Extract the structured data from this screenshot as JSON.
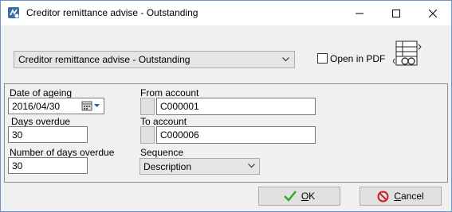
{
  "window": {
    "title": "Creditor remittance advise - Outstanding"
  },
  "report": {
    "selected": "Creditor remittance advise - Outstanding",
    "open_in_pdf_label": "Open in PDF",
    "open_in_pdf_checked": false
  },
  "form": {
    "date_of_ageing_label": "Date of ageing",
    "date_of_ageing_value": "2016/04/30",
    "days_overdue_label": "Days overdue",
    "days_overdue_value": "30",
    "number_days_overdue_label": "Number of days overdue",
    "number_days_overdue_value": "30",
    "from_account_label": "From account",
    "from_account_value": "C000001",
    "to_account_label": "To account",
    "to_account_value": "C000006",
    "sequence_label": "Sequence",
    "sequence_value": "Description"
  },
  "buttons": {
    "ok_hotkey": "O",
    "ok_rest": "K",
    "cancel_hotkey": "C",
    "cancel_rest": "ancel"
  },
  "colors": {
    "ok_check": "#2eab2e",
    "cancel_icon": "#d01c1c",
    "accent_border": "#6f94c4"
  },
  "icons": {
    "app": "remittance-app-icon",
    "report": "report-layout-icon",
    "calendar": "calendar-icon",
    "ok": "check-icon",
    "cancel": "no-entry-icon"
  }
}
